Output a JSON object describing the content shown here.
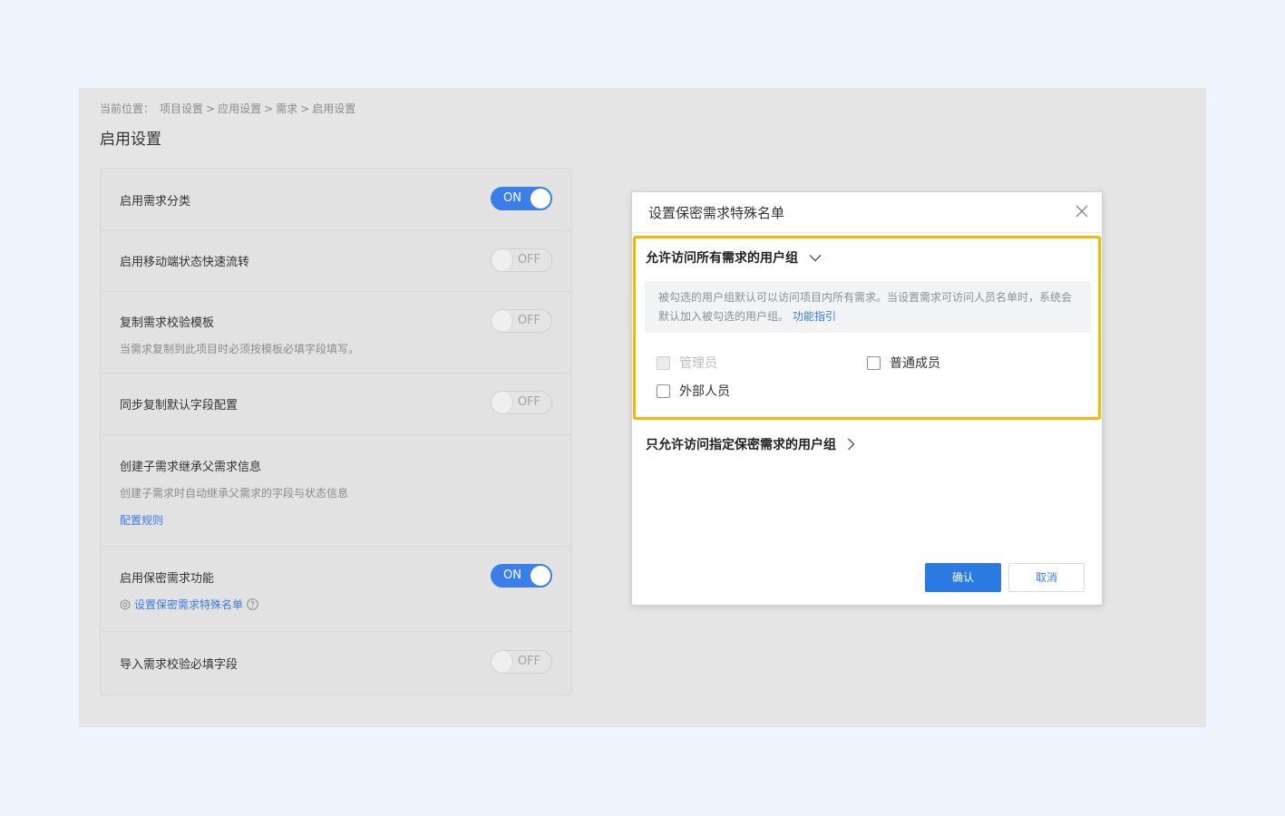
{
  "breadcrumb": {
    "prefix": "当前位置：",
    "items": [
      "项目设置",
      "应用设置",
      "需求",
      "启用设置"
    ],
    "separator": ">"
  },
  "page_title": "启用设置",
  "settings": [
    {
      "title": "启用需求分类",
      "toggle": "ON"
    },
    {
      "title": "启用移动端状态快速流转",
      "toggle": "OFF"
    },
    {
      "title": "复制需求校验模板",
      "toggle": "OFF",
      "desc": "当需求复制到此项目时必须按模板必填字段填写。"
    },
    {
      "title": "同步复制默认字段配置",
      "toggle": "OFF"
    },
    {
      "title": "创建子需求继承父需求信息",
      "desc": "创建子需求时自动继承父需求的字段与状态信息",
      "link": "配置规则"
    },
    {
      "title": "启用保密需求功能",
      "toggle": "ON",
      "link": "设置保密需求特殊名单"
    },
    {
      "title": "导入需求校验必填字段",
      "toggle": "OFF"
    }
  ],
  "modal": {
    "title": "设置保密需求特殊名单",
    "section1": {
      "title": "允许访问所有需求的用户组",
      "info": "被勾选的用户组默认可以访问项目内所有需求。当设置需求可访问人员名单时，系统会默认加入被勾选的用户组。",
      "info_link": "功能指引",
      "options": [
        {
          "label": "管理员",
          "disabled": true,
          "checked": false
        },
        {
          "label": "普通成员",
          "disabled": false,
          "checked": false
        },
        {
          "label": "外部人员",
          "disabled": false,
          "checked": false
        }
      ]
    },
    "section2": {
      "title": "只允许访问指定保密需求的用户组"
    },
    "confirm": "确认",
    "cancel": "取消"
  },
  "colors": {
    "accent": "#2a7ae2",
    "highlight": "#f5b800",
    "page_bg": "#eef5fd",
    "panel_bg": "#e5e5e5"
  }
}
